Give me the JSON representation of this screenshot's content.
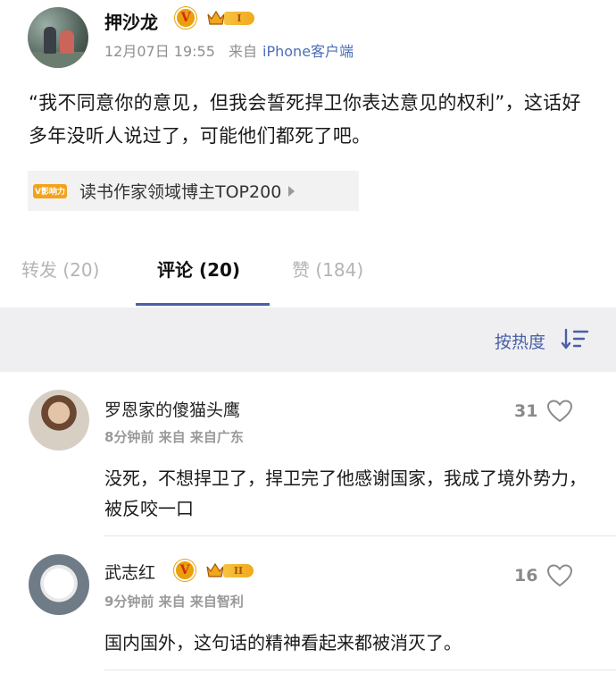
{
  "post": {
    "username": "押沙龙",
    "verified_mark": "V",
    "level_badge": "I",
    "timestamp": "12月07日 19:55",
    "source_prefix": "来自",
    "source": "iPhone客户端",
    "text": "“我不同意你的意见，但我会誓死捍卫你表达意见的权利”，这话好多年没听人说过了，可能他们都死了吧。",
    "influence_badge": "V影响力",
    "influence_label": "读书作家领域博主TOP200"
  },
  "tabs": [
    {
      "label": "转发 (20)",
      "active": false
    },
    {
      "label": "评论 (20)",
      "active": true
    },
    {
      "label": "赞 (184)",
      "active": false
    }
  ],
  "sort": {
    "label": "按热度"
  },
  "comments": [
    {
      "name": "罗恩家的傻猫头鹰",
      "meta": "8分钟前 来自 来自广东",
      "likes": "31",
      "text": "没死，不想捍卫了，捍卫完了他感谢国家，我成了境外势力，被反咬一口"
    },
    {
      "name": "武志红",
      "verified_mark": "V",
      "level_badge": "II",
      "meta": "9分钟前 来自 来自智利",
      "likes": "16",
      "text": "国内国外，这句话的精神看起来都被消灭了。"
    }
  ],
  "colors": {
    "accent": "#4a5fa8",
    "link": "#4b6fb5",
    "verified_gold": "#e8a10c",
    "sort_bar_bg": "#efeff2"
  },
  "icons": {
    "verified": "verified-v-icon",
    "level": "crown-level-icon",
    "sort": "sort-descending-icon",
    "like": "heart-icon",
    "chevron": "chevron-right-icon"
  }
}
